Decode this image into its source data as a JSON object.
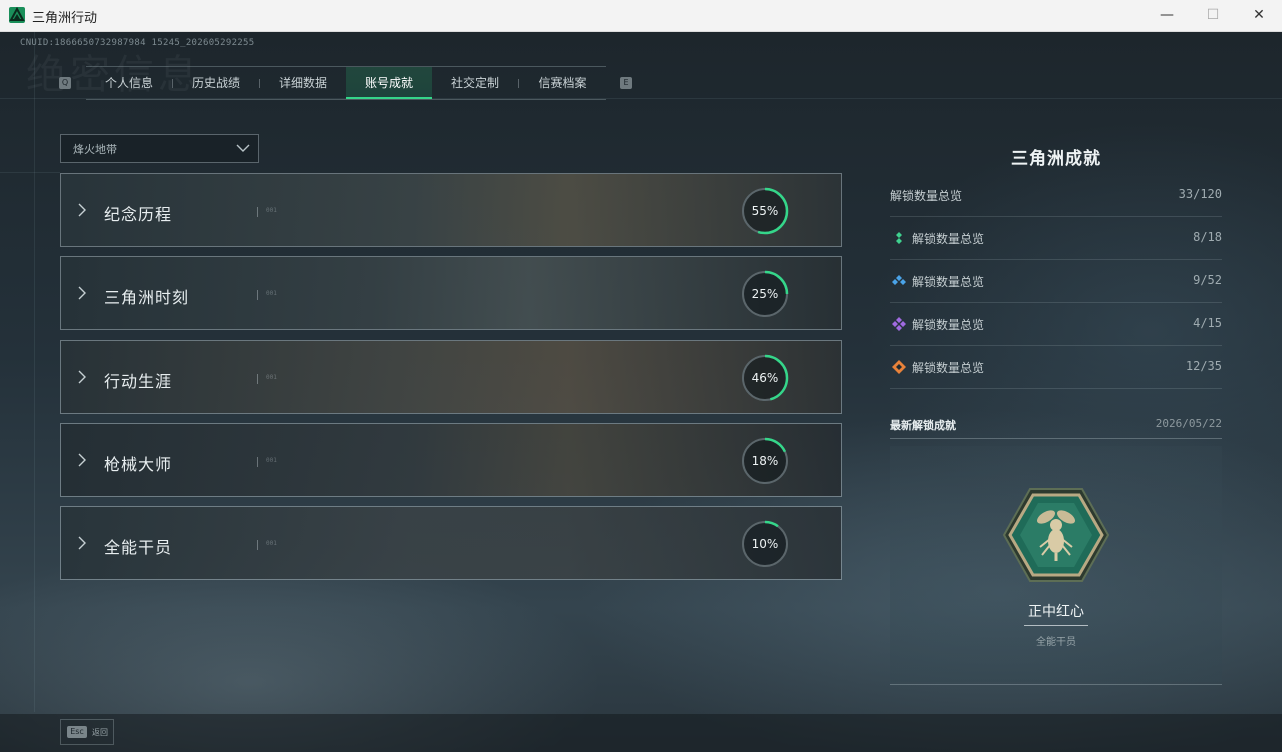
{
  "window": {
    "title": "三角洲行动",
    "minimize_glyph": "—",
    "maximize_glyph": "☐",
    "close_glyph": "✕"
  },
  "header": {
    "uid": "CNUID:1866650732987984 15245_202605292255"
  },
  "tabs": {
    "prev_key": "Q",
    "next_key": "E",
    "items": [
      {
        "label": "个人信息"
      },
      {
        "label": "历史战绩"
      },
      {
        "label": "详细数据"
      },
      {
        "label": "账号成就",
        "active": true
      },
      {
        "label": "社交定制"
      },
      {
        "label": "信赛档案"
      }
    ]
  },
  "filter": {
    "selected": "烽火地带"
  },
  "categories": [
    {
      "label": "纪念历程",
      "percent_text": "55%",
      "progress": 0.55
    },
    {
      "label": "三角洲时刻",
      "percent_text": "25%",
      "progress": 0.25
    },
    {
      "label": "行动生涯",
      "percent_text": "46%",
      "progress": 0.46
    },
    {
      "label": "枪械大师",
      "percent_text": "18%",
      "progress": 0.18
    },
    {
      "label": "全能干员",
      "percent_text": "10%",
      "progress": 0.1
    }
  ],
  "summary": {
    "title": "三角洲成就",
    "total": {
      "label": "解锁数量总览",
      "value": "33/120"
    },
    "tiers": [
      {
        "label": "解锁数量总览",
        "value": "8/18",
        "icon": "green-tier-icon",
        "color": "#3fd18f"
      },
      {
        "label": "解锁数量总览",
        "value": "9/52",
        "icon": "blue-tier-icon",
        "color": "#4aa3e8"
      },
      {
        "label": "解锁数量总览",
        "value": "4/15",
        "icon": "purple-tier-icon",
        "color": "#a06ae0"
      },
      {
        "label": "解锁数量总览",
        "value": "12/35",
        "icon": "orange-tier-icon",
        "color": "#e8823a"
      }
    ]
  },
  "latest": {
    "label": "最新解锁成就",
    "date": "2026/05/22",
    "badge_name": "正中红心",
    "badge_category": "全能干员",
    "badge_icon": "wasp-badge-icon"
  },
  "footer": {
    "esc_key": "Esc",
    "esc_label": "返回"
  },
  "colors": {
    "accent": "#35d68a",
    "progress_track": "#5b666b"
  }
}
